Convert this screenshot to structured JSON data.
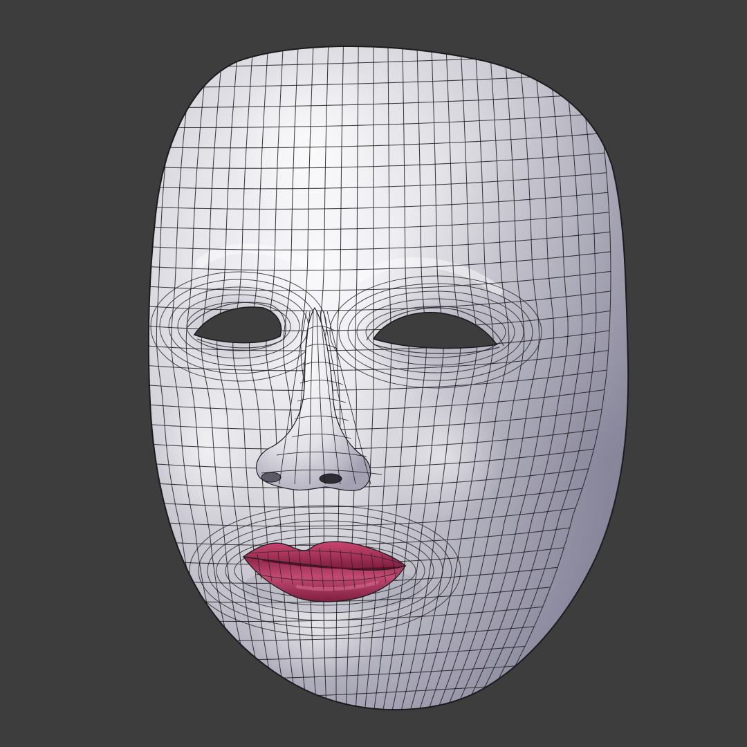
{
  "scene": {
    "subject": "mask-3d-model",
    "background_color": "#3d3d3d",
    "mask_base_color": "#e7e6ea",
    "mask_shadow_color": "#8a889d",
    "wire_color": "#1c1c1f",
    "lips_color": "#b0395f",
    "lips_highlight": "#d45c82",
    "lips_shadow": "#6e1530"
  }
}
